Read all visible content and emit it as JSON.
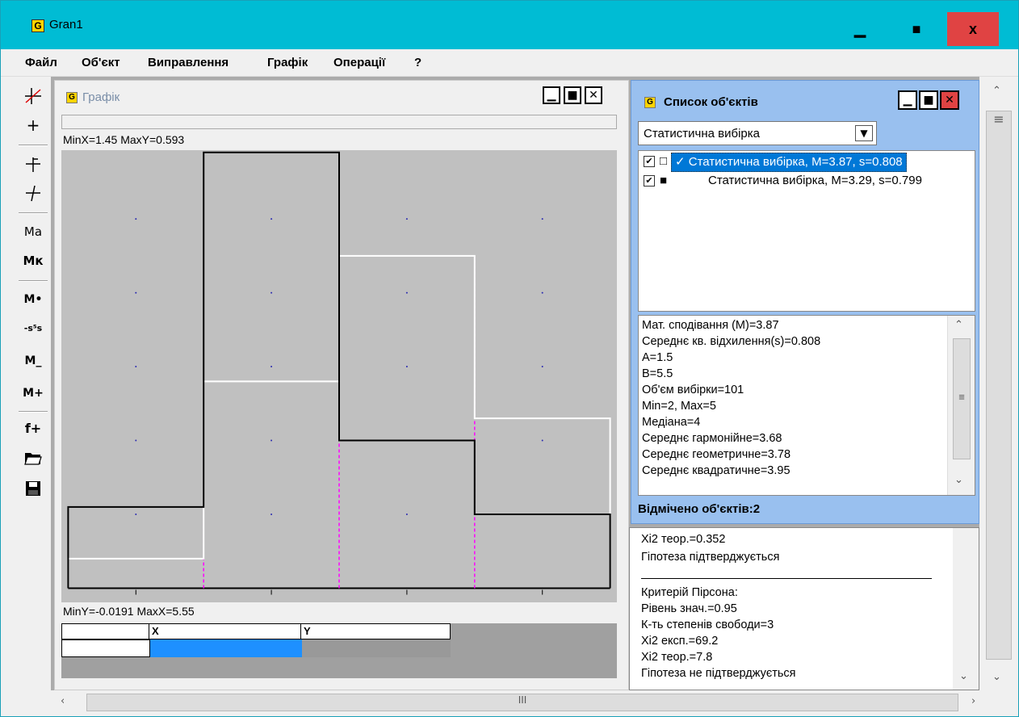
{
  "window": {
    "icon_letter": "G",
    "title": "Gran1",
    "min_glyph": "▁",
    "max_glyph": "■",
    "close_glyph": "x"
  },
  "menu": [
    "Файл",
    "Об'єкт",
    "Виправлення",
    "Графік",
    "Операції",
    "?"
  ],
  "toolbar_icons": [
    "function-strike-icon",
    "crosshair-icon",
    "axis-cross-icon",
    "axis-skew-icon",
    "Ma",
    "Mк",
    "M•",
    "s-sample-icon",
    "M−",
    "M+",
    "f+",
    "open-folder-icon",
    "save-icon"
  ],
  "toolbar_text": {
    "ma": "Mа",
    "mk": "Mк",
    "mdot": "M•",
    "ss": "-s⁵s",
    "mminus": "M_",
    "mplus": "M+",
    "fplus": "f+"
  },
  "graph": {
    "icon_letter": "G",
    "title": "Графік",
    "min_max_top": "MinX=1.45  MaxY=0.593",
    "min_max_bottom": "MinY=-0.0191  MaxX=5.55",
    "table_headers": [
      "X",
      "Y"
    ]
  },
  "chart_data": {
    "type": "bar",
    "x_range": [
      1.45,
      5.55
    ],
    "y_range": [
      -0.0191,
      0.593
    ],
    "bins": [
      [
        1.5,
        2.5
      ],
      [
        2.5,
        3.5
      ],
      [
        3.5,
        4.5
      ],
      [
        4.5,
        5.5
      ]
    ],
    "series": [
      {
        "name": "Статистична вибірка, M=3.87, s=0.808",
        "color": "#ffffff",
        "values": [
          0.04,
          0.28,
          0.45,
          0.23
        ]
      },
      {
        "name": "Статистична вибірка, M=3.29, s=0.799",
        "color": "#000000",
        "values": [
          0.11,
          0.59,
          0.2,
          0.1
        ]
      }
    ],
    "grid": true,
    "boundary_color": "#ff00ff"
  },
  "objects": {
    "icon_letter": "G",
    "title": "Список об'єктів",
    "select_value": "Статистична вибірка",
    "items": [
      {
        "checked": true,
        "marker": "□",
        "selected": true,
        "label": "✓ Статистична вибірка, M=3.87, s=0.808"
      },
      {
        "checked": true,
        "marker": "■",
        "selected": false,
        "label": "Статистична вибірка, M=3.29, s=0.799"
      }
    ],
    "stats": [
      "Мат. сподівання (M)=3.87",
      "Середнє кв. відхилення(s)=0.808",
      "A=1.5",
      "B=5.5",
      "Об'єм вибірки=101",
      "Min=2, Max=5",
      "Медіана=4",
      "Середнє гармонійне=3.68",
      "Середнє геометричне=3.78",
      "Середнє квадратичне=3.95"
    ],
    "selected_count": "Відмічено об'єктів:2"
  },
  "log": [
    "Xi2 теор.=0.352",
    "Гіпотеза підтверджується",
    "",
    "Критерій Пірсона:",
    "Рівень знач.=0.95",
    "К-ть степенів свободи=3",
    "Xi2 експ.=69.2",
    "Xi2 теор.=7.8",
    "Гіпотеза не підтверджується"
  ]
}
